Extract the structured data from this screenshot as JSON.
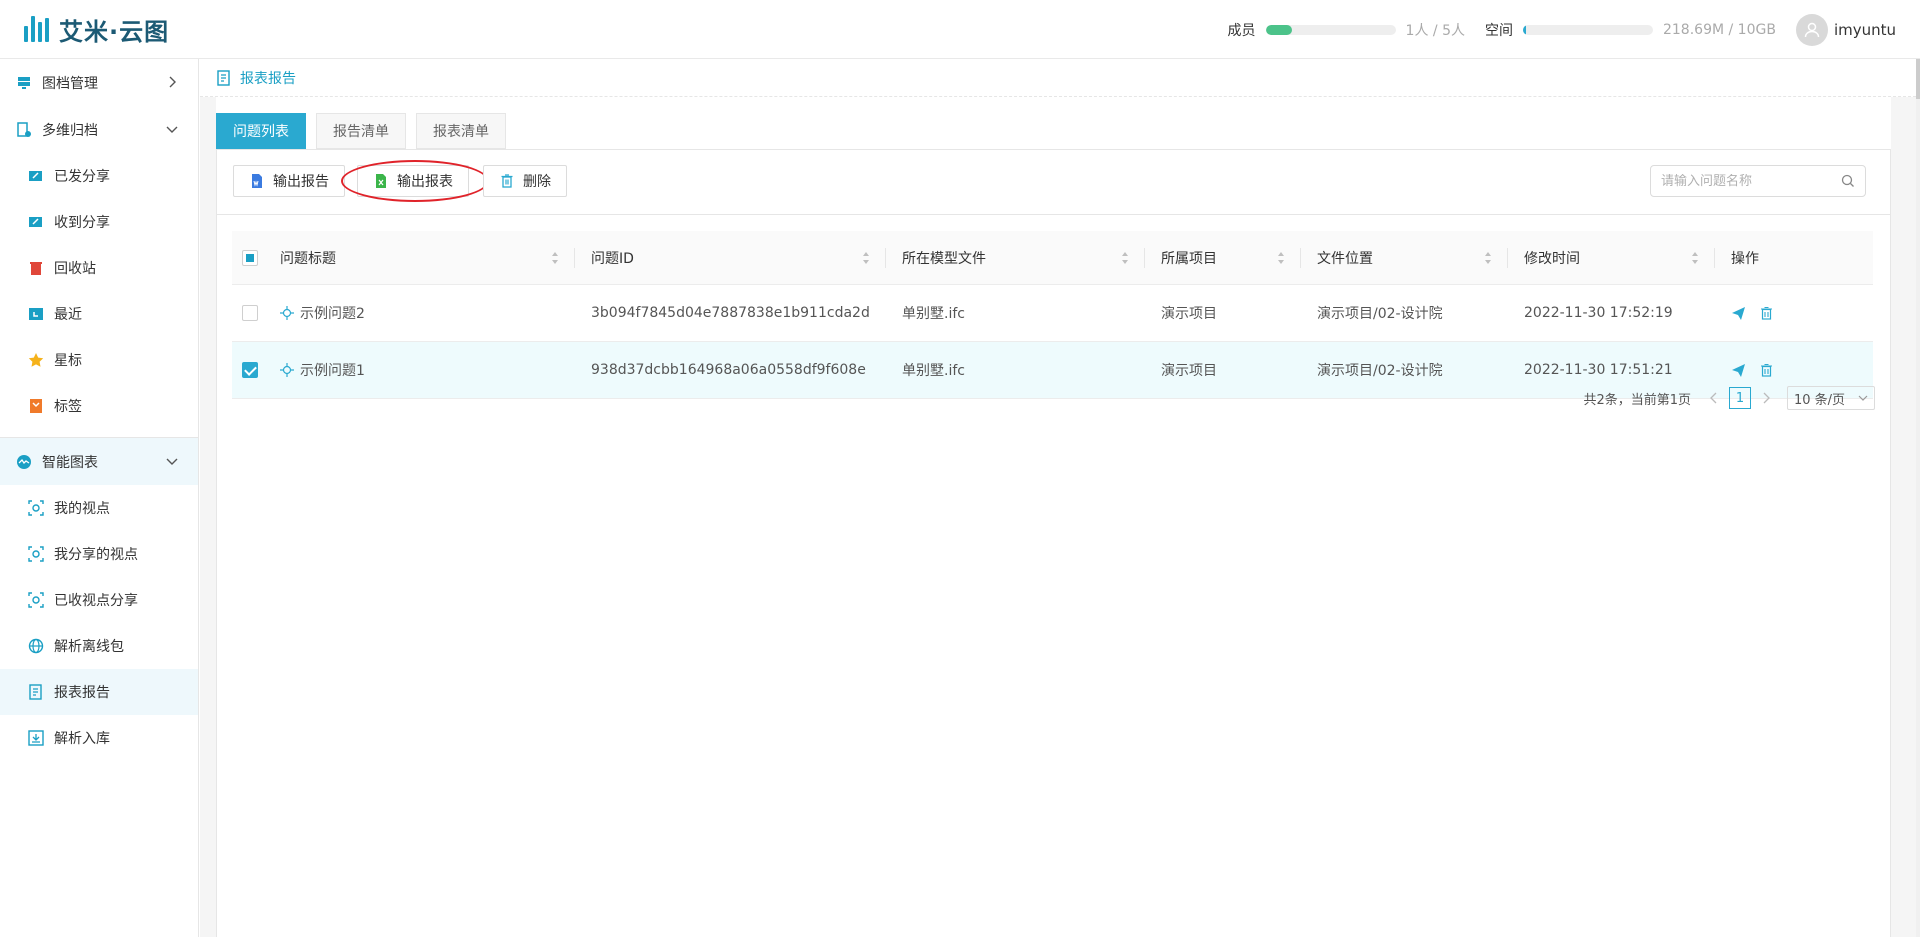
{
  "app": {
    "title": "艾米·云图"
  },
  "header": {
    "members_label": "成员",
    "members_value": "1人 / 5人",
    "members_fraction": 0.2,
    "space_label": "空间",
    "space_value": "218.69M / 10GB",
    "space_fraction": 0.02,
    "username": "imyuntu"
  },
  "sidebar": {
    "groups": [
      {
        "label": "图档管理",
        "icon": "archive-icon",
        "expanded": false
      },
      {
        "label": "多维归档",
        "icon": "folder-settings-icon",
        "expanded": true,
        "items": [
          {
            "label": "已发分享",
            "icon": "share-out-icon"
          },
          {
            "label": "收到分享",
            "icon": "share-in-icon"
          },
          {
            "label": "回收站",
            "icon": "trash-icon"
          },
          {
            "label": "最近",
            "icon": "clock-icon"
          },
          {
            "label": "星标",
            "icon": "star-icon"
          },
          {
            "label": "标签",
            "icon": "tag-icon"
          }
        ]
      },
      {
        "label": "智能图表",
        "icon": "smart-chart-icon",
        "expanded": true,
        "items": [
          {
            "label": "我的视点",
            "icon": "viewpoint-icon"
          },
          {
            "label": "我分享的视点",
            "icon": "viewpoint-share-icon"
          },
          {
            "label": "已收视点分享",
            "icon": "viewpoint-received-icon"
          },
          {
            "label": "解析离线包",
            "icon": "globe-icon"
          },
          {
            "label": "报表报告",
            "icon": "report-icon",
            "active": true
          },
          {
            "label": "解析入库",
            "icon": "import-icon"
          }
        ]
      }
    ]
  },
  "breadcrumb": {
    "label": "报表报告"
  },
  "tabs": [
    {
      "label": "问题列表",
      "active": true
    },
    {
      "label": "报告清单",
      "active": false
    },
    {
      "label": "报表清单",
      "active": false
    }
  ],
  "toolbar": {
    "export_report": "输出报告",
    "export_sheet": "输出报表",
    "delete": "删除",
    "search_placeholder": "请输入问题名称"
  },
  "table": {
    "columns": [
      "问题标题",
      "问题ID",
      "所在模型文件",
      "所属项目",
      "文件位置",
      "修改时间",
      "操作"
    ],
    "rows": [
      {
        "title": "示例问题2",
        "id": "3b094f7845d04e7887838e1b911cda2d",
        "model": "单别墅.ifc",
        "project": "演示项目",
        "location": "演示项目/02-设计院",
        "modified": "2022-11-30 17:52:19",
        "selected": false
      },
      {
        "title": "示例问题1",
        "id": "938d37dcbb164968a06a0558df9f608e",
        "model": "单别墅.ifc",
        "project": "演示项目",
        "location": "演示项目/02-设计院",
        "modified": "2022-11-30 17:51:21",
        "selected": true
      }
    ]
  },
  "pagination": {
    "summary": "共2条，当前第1页",
    "current_page": "1",
    "page_size": "10 条/页"
  },
  "colors": {
    "accent": "#2aa9d0",
    "members_bar": "#4cc38a",
    "highlight_ring": "#e0232a"
  }
}
